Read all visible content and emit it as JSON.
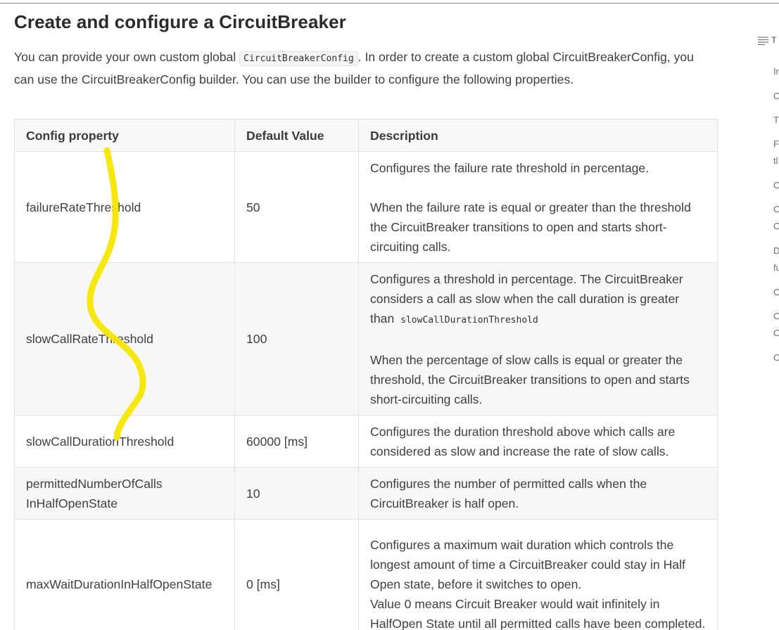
{
  "page": {
    "heading": "Create and configure a CircuitBreaker",
    "intro": {
      "before_code": "You can provide your own custom global ",
      "code": "CircuitBreakerConfig",
      "after_code": ". In order to create a custom global CircuitBreakerConfig, you can use the CircuitBreakerConfig builder. You can use the builder to configure the following properties."
    }
  },
  "table": {
    "headers": [
      "Config property",
      "Default Value",
      "Description"
    ],
    "rows": [
      {
        "property": "failureRateThreshold",
        "default": "50",
        "desc_1": "Configures the failure rate threshold in percentage.",
        "desc_2": "When the failure rate is equal or greater than the threshold the CircuitBreaker transitions to open and starts short-circuiting calls."
      },
      {
        "property": "slowCallRateThreshold",
        "default": "100",
        "desc_1": "Configures a threshold in percentage. The CircuitBreaker considers a call as slow when the call duration is greater than ",
        "desc_code": "slowCallDurationThreshold",
        "desc_2": "When the percentage of slow calls is equal or greater the threshold, the CircuitBreaker transitions to open and starts short-circuiting calls."
      },
      {
        "property": "slowCallDurationThreshold",
        "default": "60000 [ms]",
        "desc_1": "Configures the duration threshold above which calls are considered as slow and increase the rate of slow calls."
      },
      {
        "property_line1": "permittedNumberOfCalls",
        "property_line2": "InHalfOpenState",
        "default": "10",
        "desc_1": "Configures the number of permitted calls when the CircuitBreaker is half open."
      },
      {
        "property": "maxWaitDurationInHalfOpenState",
        "default": "0 [ms]",
        "desc_1": "Configures a maximum wait duration which controls the longest amount of time a CircuitBreaker could stay in Half Open state, before it switches to open.",
        "desc_2": "Value 0 means Circuit Breaker would wait infinitely in HalfOpen State until all permitted calls have been completed."
      }
    ]
  },
  "toc": {
    "header_icon": "list-lines-icon",
    "header": "T",
    "items": [
      "Ir",
      "C",
      "T",
      "F",
      "tl",
      "C",
      "C",
      "C",
      "D",
      "fu",
      "C",
      "C",
      "C",
      "C"
    ]
  },
  "annotation": {
    "color": "#f7e600"
  }
}
